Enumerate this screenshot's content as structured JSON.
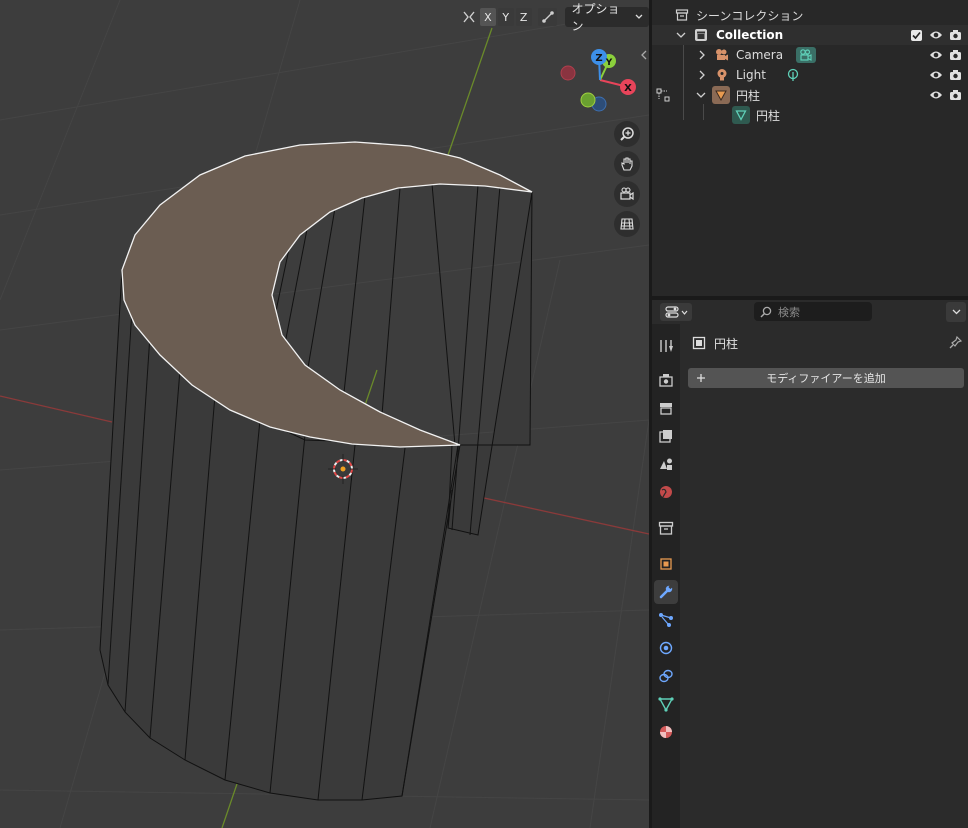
{
  "viewport": {
    "axes": [
      "X",
      "Y",
      "Z"
    ],
    "options_label": "オプション",
    "gizmo": {
      "x_label": "X",
      "y_label": "Y",
      "z_label": "Z"
    },
    "nav_tools": [
      "zoom-icon",
      "pan-hand-icon",
      "camera-view-icon",
      "grid-view-icon"
    ]
  },
  "outliner": {
    "scene_collection": "シーンコレクション",
    "collection": "Collection",
    "items": [
      {
        "label": "Camera"
      },
      {
        "label": "Light"
      },
      {
        "label": "円柱"
      }
    ],
    "mesh_data": "円柱"
  },
  "properties": {
    "search_placeholder": "検索",
    "object_name": "円柱",
    "add_modifier_label": "モディファイアーを追加",
    "active_tab": "modifier",
    "tabs": [
      "tool",
      "render",
      "output",
      "view-layer",
      "scene",
      "world",
      "collection",
      "object",
      "modifier",
      "particles",
      "physics",
      "constraints",
      "object-data",
      "material"
    ]
  },
  "colors": {
    "viewport_bg": "#3d3d3d",
    "panel_bg": "#282828",
    "x_axis": "#e8445a",
    "y_axis": "#8bd03c",
    "z_axis": "#3d8fe8",
    "face_selected": "#6b5d52"
  }
}
